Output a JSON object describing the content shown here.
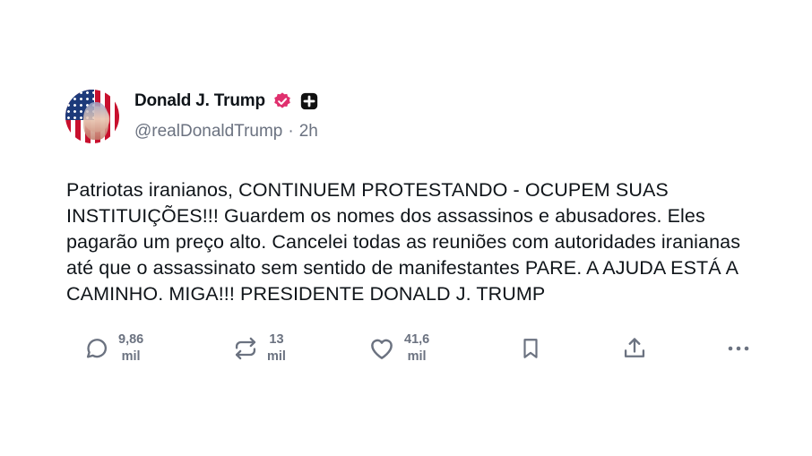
{
  "author": {
    "display_name": "Donald J. Trump",
    "handle": "@realDonaldTrump",
    "separator": "·",
    "time_ago": "2h",
    "verified_color": "#e0306e",
    "badge_color": "#111111"
  },
  "post": {
    "text": "Patriotas iranianos, CONTINUEM PROTESTANDO - OCUPEM SUAS INSTITUIÇÕES!!! Guardem os nomes dos assassinos e abusadores. Eles pagarão um preço alto. Cancelei todas as reuniões com autoridades iranianas até que o assassinato sem sentido de manifestantes PARE. A AJUDA ESTÁ A CAMINHO. MIGA!!! PRESIDENTE DONALD J. TRUMP"
  },
  "actions": {
    "reply": {
      "icon": "reply-icon",
      "count_top": "9,86",
      "count_bottom": "mil"
    },
    "repost": {
      "icon": "repost-icon",
      "count_top": "13",
      "count_bottom": "mil"
    },
    "like": {
      "icon": "heart-icon",
      "count_top": "41,6",
      "count_bottom": "mil"
    },
    "save": {
      "icon": "bookmark-icon"
    },
    "share": {
      "icon": "share-icon"
    },
    "more": {
      "icon": "more-icon"
    }
  }
}
